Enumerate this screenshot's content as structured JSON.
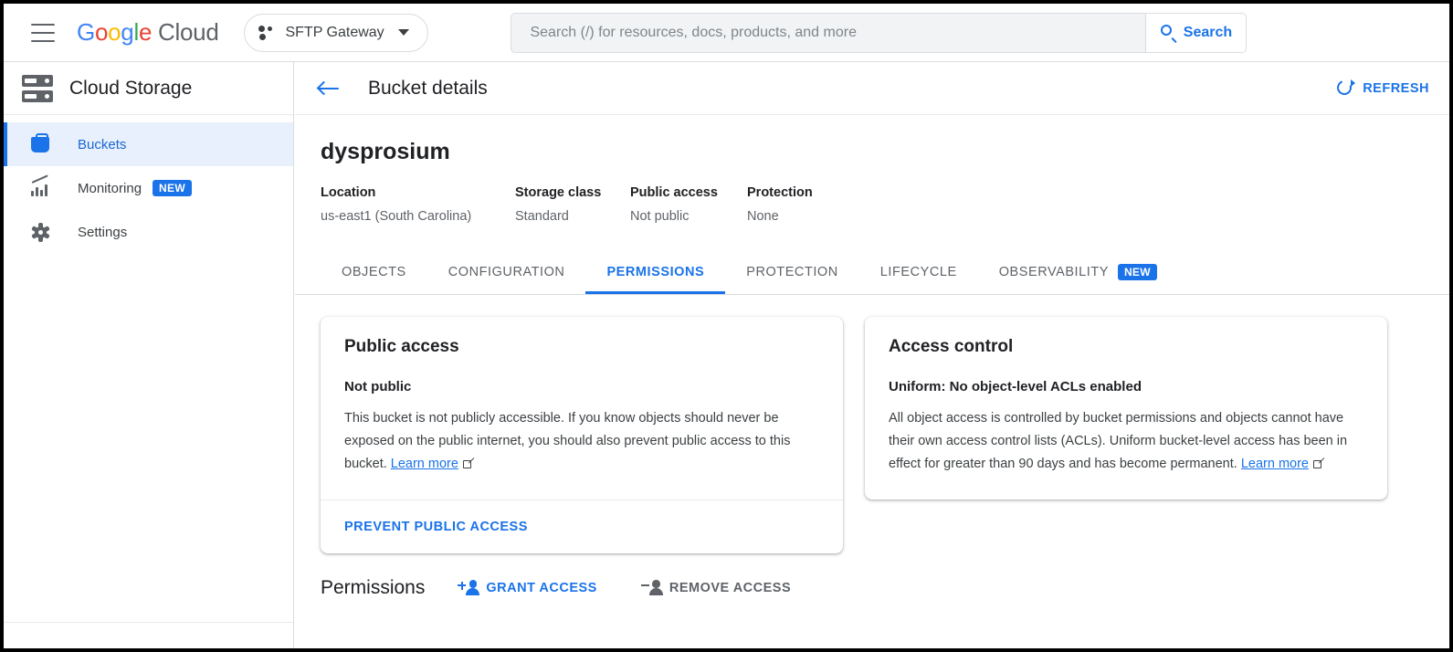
{
  "topbar": {
    "menu_icon": "hamburger-menu-icon",
    "logo": {
      "g1": "G",
      "g2": "o",
      "g3": "o",
      "g4": "g",
      "g5": "l",
      "g6": "e",
      "cloud": "Cloud"
    },
    "project": {
      "name": "SFTP Gateway",
      "icon": "project-dots-icon",
      "caret": "chevron-down-icon"
    },
    "search": {
      "placeholder": "Search (/) for resources, docs, products, and more",
      "value": "",
      "button_label": "Search",
      "button_icon": "search-icon"
    }
  },
  "sidebar": {
    "product_icon": "cloud-storage-icon",
    "product_title": "Cloud Storage",
    "items": [
      {
        "label": "Buckets",
        "icon": "bucket-icon",
        "active": true,
        "badge": ""
      },
      {
        "label": "Monitoring",
        "icon": "monitoring-chart-icon",
        "active": false,
        "badge": "NEW"
      },
      {
        "label": "Settings",
        "icon": "gear-icon",
        "active": false,
        "badge": ""
      }
    ]
  },
  "page": {
    "back_icon": "arrow-left-icon",
    "title": "Bucket details",
    "refresh": {
      "label": "REFRESH",
      "icon": "refresh-icon"
    }
  },
  "bucket": {
    "name": "dysprosium",
    "meta": [
      {
        "label": "Location",
        "value": "us-east1 (South Carolina)"
      },
      {
        "label": "Storage class",
        "value": "Standard"
      },
      {
        "label": "Public access",
        "value": "Not public"
      },
      {
        "label": "Protection",
        "value": "None"
      }
    ]
  },
  "tabs": [
    {
      "label": "OBJECTS",
      "active": false,
      "badge": ""
    },
    {
      "label": "CONFIGURATION",
      "active": false,
      "badge": ""
    },
    {
      "label": "PERMISSIONS",
      "active": true,
      "badge": ""
    },
    {
      "label": "PROTECTION",
      "active": false,
      "badge": ""
    },
    {
      "label": "LIFECYCLE",
      "active": false,
      "badge": ""
    },
    {
      "label": "OBSERVABILITY",
      "active": false,
      "badge": "NEW"
    }
  ],
  "public_access_card": {
    "title": "Public access",
    "status": "Not public",
    "description": "This bucket is not publicly accessible. If you know objects should never be exposed on the public internet, you should also prevent public access to this bucket.",
    "learn_more": "Learn more",
    "external_icon": "external-link-icon",
    "action": "PREVENT PUBLIC ACCESS"
  },
  "access_control_card": {
    "title": "Access control",
    "status": "Uniform: No object-level ACLs enabled",
    "description": "All object access is controlled by bucket permissions and objects cannot have their own access control lists (ACLs). Uniform bucket-level access has been in effect for greater than 90 days and has become permanent.",
    "learn_more": "Learn more",
    "external_icon": "external-link-icon"
  },
  "permissions": {
    "title": "Permissions",
    "grant": {
      "label": "GRANT ACCESS",
      "icon": "person-add-icon"
    },
    "remove": {
      "label": "REMOVE ACCESS",
      "icon": "person-remove-icon"
    }
  },
  "colors": {
    "accent_blue": "#1a73e8",
    "active_nav_bg": "#e8f0fe",
    "text_primary": "#202124",
    "text_secondary": "#5f6368",
    "border": "#dadce0",
    "search_bg": "#f1f3f4"
  }
}
